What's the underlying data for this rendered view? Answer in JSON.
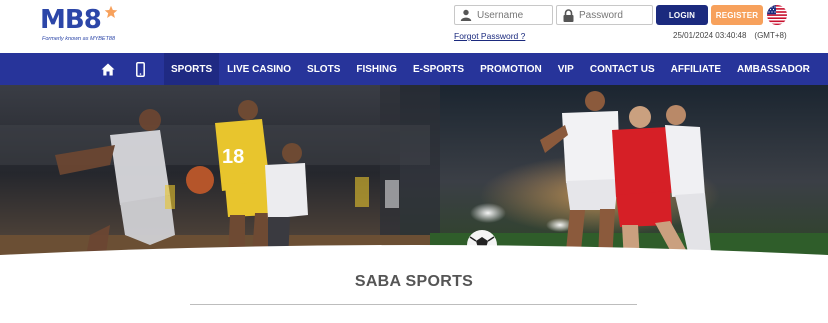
{
  "brand": {
    "logo_text": "MB8",
    "tagline": "Formerly known as MYBET88"
  },
  "auth": {
    "username_placeholder": "Username",
    "password_placeholder": "Password",
    "login_label": "LOGIN",
    "register_label": "REGISTER",
    "forgot_label": "Forgot Password ?",
    "language_flag_icon": "us-flag-icon"
  },
  "clock": {
    "datetime": "25/01/2024 03:40:48",
    "timezone": "(GMT+8)"
  },
  "nav": {
    "home_icon": "home-icon",
    "mobile_icon": "mobile-icon",
    "items": [
      {
        "label": "SPORTS",
        "active": true
      },
      {
        "label": "LIVE CASINO"
      },
      {
        "label": "SLOTS"
      },
      {
        "label": "FISHING"
      },
      {
        "label": "E-SPORTS"
      },
      {
        "label": "PROMOTION"
      },
      {
        "label": "VIP"
      },
      {
        "label": "CONTACT US"
      },
      {
        "label": "AFFILIATE"
      },
      {
        "label": "AMBASSADOR"
      }
    ]
  },
  "banner": {
    "left_jersey_number": "18"
  },
  "section": {
    "title": "SABA SPORTS"
  },
  "colors": {
    "nav_bg": "#27349a",
    "login_bg": "#1b2a7e",
    "register_bg": "#f7a15c",
    "brand_blue": "#2c46a8"
  }
}
